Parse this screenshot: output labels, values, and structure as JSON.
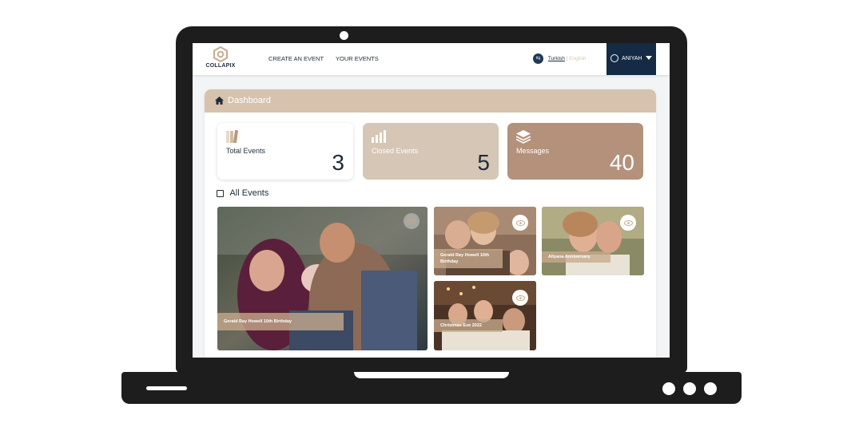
{
  "navbar": {
    "logo_text": "COLLAPIX",
    "links": [
      "CREATE AN EVENT",
      "YOUR EVENTS"
    ],
    "language": {
      "active": "Turkish",
      "separator": "|",
      "other": "English"
    },
    "user": {
      "name": "ANIYAH",
      "icon": "user-circle-icon",
      "caret": "chevron-down-icon"
    }
  },
  "dashboard": {
    "title": "Dashboard",
    "icon": "home-icon",
    "stats": [
      {
        "label": "Total Events",
        "value": "3",
        "icon": "books-icon"
      },
      {
        "label": "Closed Events",
        "value": "5",
        "icon": "bar-chart-icon"
      },
      {
        "label": "Messages",
        "value": "40",
        "icon": "layers-icon"
      }
    ],
    "events_heading": "All Events",
    "events": [
      {
        "title": "Gerald Ray Howell 10th Birthday",
        "icon": "eye-icon"
      },
      {
        "title": "Gerald Ray Howell 10th Birthday",
        "icon": "eye-icon"
      },
      {
        "title": "Allyana Anniversary",
        "icon": "eye-icon"
      },
      {
        "title": "Christmas Eve 2022",
        "icon": "eye-icon"
      }
    ]
  },
  "colors": {
    "navy": "#142a45",
    "beige_header": "#d6c2ad",
    "light_tan_card": "#d6c6b6",
    "brown_card": "#b4917a"
  }
}
